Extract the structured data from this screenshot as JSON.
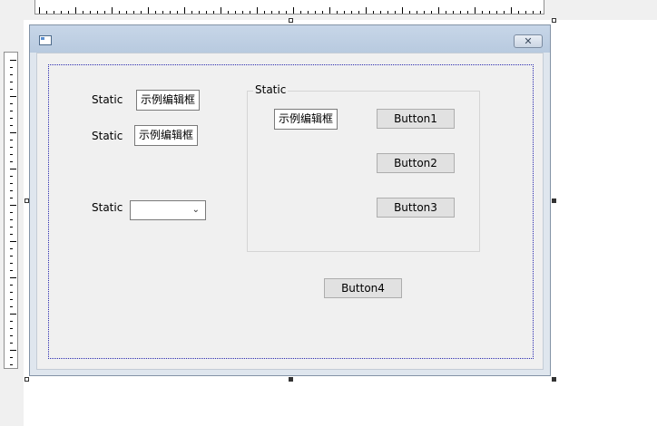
{
  "window": {
    "close_glyph": "✕",
    "app_icon": "dialog-app-icon"
  },
  "left_column": {
    "row1": {
      "label": "Static",
      "edit_value": "示例编辑框"
    },
    "row2": {
      "label": "Static",
      "edit_value": "示例编辑框"
    },
    "row3": {
      "label": "Static",
      "combo_value": "",
      "combo_arrow": "⌄"
    }
  },
  "group": {
    "caption": "Static",
    "edit_value": "示例编辑框",
    "buttons": [
      "Button1",
      "Button2",
      "Button3"
    ]
  },
  "bottom_button": "Button4",
  "colors": {
    "titlebar": "#c7d6e8",
    "client": "#f0f0f0",
    "guide": "#2b2bb0",
    "button": "#e1e1e1"
  }
}
